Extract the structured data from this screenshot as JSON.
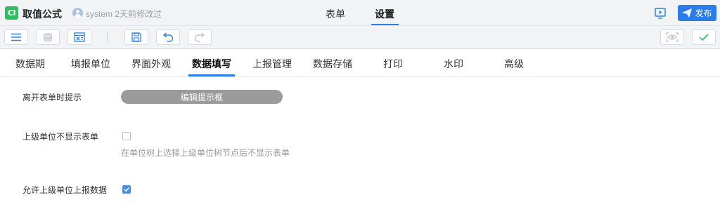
{
  "header": {
    "logo_text": "CI",
    "app_title": "取值公式",
    "modify_info": "system 2天前修改过",
    "tabs": [
      {
        "label": "表单"
      },
      {
        "label": "设置"
      }
    ],
    "publish_label": "发布"
  },
  "settings_tabs": [
    {
      "label": "数据期"
    },
    {
      "label": "填报单位"
    },
    {
      "label": "界面外观"
    },
    {
      "label": "数据填写"
    },
    {
      "label": "上报管理"
    },
    {
      "label": "数据存储"
    },
    {
      "label": "打印"
    },
    {
      "label": "水印"
    },
    {
      "label": "高级"
    }
  ],
  "active_tab": "数据填写",
  "settings": {
    "leave_tip": {
      "label": "离开表单时提示",
      "button_label": "编辑提示框"
    },
    "hide_parent": {
      "label": "上级单位不显示表单",
      "checked": false,
      "hint": "在单位树上选择上级单位树节点后不显示表单"
    },
    "allow_parent_report": {
      "label": "允许上级单位上报数据",
      "checked": true
    }
  },
  "colors": {
    "accent": "#2b7de9",
    "logo": "#2dbe60",
    "tip_button": "#9b9b9b",
    "confirm": "#2dbe60"
  }
}
